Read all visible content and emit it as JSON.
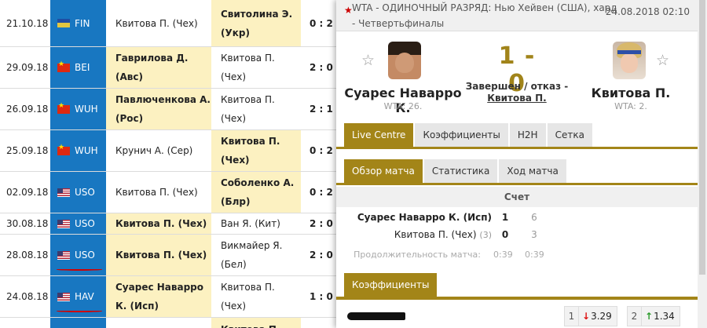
{
  "matches": [
    {
      "date": "21.10.18",
      "tournament": "FIN",
      "flag": "fin",
      "p1": "Квитова П. (Чех)",
      "p2": "Свитолина Э. (Укр)",
      "score": "0 : 2",
      "winner": 2
    },
    {
      "date": "29.09.18",
      "tournament": "BEI",
      "flag": "cn",
      "p1": "Гаврилова Д. (Авс)",
      "p2": "Квитова П. (Чех)",
      "score": "2 : 0",
      "winner": 1
    },
    {
      "date": "26.09.18",
      "tournament": "WUH",
      "flag": "cn",
      "p1": "Павлюченкова А. (Рос)",
      "p2": "Квитова П. (Чех)",
      "score": "2 : 1",
      "winner": 1
    },
    {
      "date": "25.09.18",
      "tournament": "WUH",
      "flag": "cn",
      "p1": "Крунич А. (Сер)",
      "p2": "Квитова П. (Чех)",
      "score": "0 : 2",
      "winner": 2
    },
    {
      "date": "02.09.18",
      "tournament": "USO",
      "flag": "us",
      "p1": "Квитова П. (Чех)",
      "p2": "Соболенко А. (Блр)",
      "score": "0 : 2",
      "winner": 2
    },
    {
      "date": "30.08.18",
      "tournament": "USO",
      "flag": "us",
      "p1": "Квитова П. (Чех)",
      "p2": "Ван Я. (Кит)",
      "score": "2 : 0",
      "winner": 1
    },
    {
      "date": "28.08.18",
      "tournament": "USO",
      "flag": "us",
      "p1": "Квитова П. (Чех)",
      "p2": "Викмайер Я. (Бел)",
      "score": "2 : 0",
      "winner": 1
    },
    {
      "date": "24.08.18",
      "tournament": "HAV",
      "flag": "us",
      "p1": "Суарес Наварро К. (Исп)",
      "p2": "Квитова П. (Чех)",
      "score": "1 : 0",
      "winner": 1
    },
    {
      "date": "",
      "tournament": "",
      "flag": "",
      "p1": "",
      "p2": "Квитова П.",
      "score": "",
      "winner": 2
    }
  ],
  "popup": {
    "header_title": "WTA - ОДИНОЧНЫЙ РАЗРЯД: Нью Хейвен (США), хард - Четвертьфиналы",
    "header_datetime": "24.08.2018 02:10",
    "player1": {
      "name": "Суарес Наварро К.",
      "rank": "WTA: 26."
    },
    "player2": {
      "name": "Квитова П.",
      "rank": "WTA: 2."
    },
    "score": "1 - 0",
    "status": "Завершен / отказ -",
    "status_player": "Квитова П.",
    "main_tabs": [
      "Live Centre",
      "Коэффициенты",
      "H2H",
      "Сетка"
    ],
    "sub_tabs": [
      "Обзор матча",
      "Статистика",
      "Ход матча"
    ],
    "summary_header": "Счет",
    "summary_rows": [
      {
        "name": "Суарес Наварро К. (Исп)",
        "rank": "",
        "score": "1",
        "set1": "6"
      },
      {
        "name": "Квитова П. (Чех)",
        "rank": "(3)",
        "score": "0",
        "set1": "3"
      }
    ],
    "duration_label": "Продолжительность матча:",
    "duration_total": "0:39",
    "duration_set1": "0:39",
    "odds_tab": "Коэффициенты",
    "odds": [
      {
        "key": "1",
        "value": "3.29",
        "direction": "down"
      },
      {
        "key": "2",
        "value": "1.34",
        "direction": "up"
      }
    ],
    "colors": {
      "accent": "#a38518",
      "tournament_blue": "#1877c1",
      "winner_highlight": "#fcf1c1"
    }
  }
}
